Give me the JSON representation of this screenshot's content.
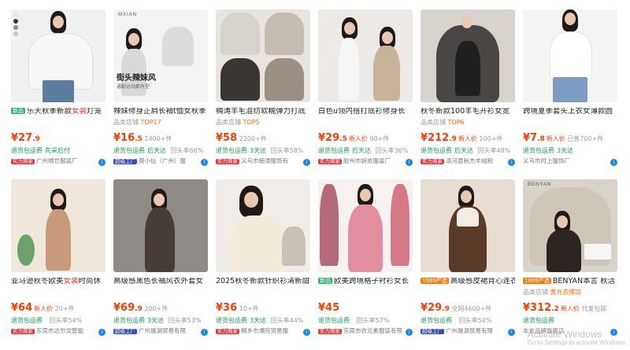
{
  "products": [
    {
      "tag": "新品",
      "tag_type": "g",
      "title": "乐天秋季新款",
      "title_red": "女装",
      "title_tail": "灯笼",
      "sub": "",
      "store": "",
      "price_int": "27",
      "price_dec": ".9",
      "new_label": "",
      "sales": "",
      "return_label": "退货包运费",
      "return_tail": "先采后付",
      "factory_label": "实力商家",
      "location": "广州绑世服装厂",
      "badge": "r"
    },
    {
      "tag": "",
      "tag_type": "",
      "title": "辣妹修身正肩长袖t恤女秋季",
      "title_red": "",
      "title_tail": "",
      "sub": "品类店铺",
      "store": "TOP17",
      "price_int": "16",
      "price_dec": ".5",
      "new_label": "",
      "sales": "2400+件",
      "return_label": "退货包运费",
      "return_tail": "后天达",
      "return_rate": "回头率66%",
      "factory_label": "超级工厂",
      "location": "莫小仙（广州）服",
      "badge": "b",
      "photo_label": "MXIAN",
      "photo_text": "街头辣妹风",
      "photo_sub": "通勤运动都有型"
    },
    {
      "tag": "",
      "tag_type": "",
      "title": "楠涛羊毛混纺软糯弹力打底",
      "title_red": "",
      "title_tail": "",
      "sub": "品类店铺",
      "store": "TOP5",
      "price_int": "58",
      "price_dec": "",
      "new_label": "",
      "sales": "2200+件",
      "return_label": "退货包运费",
      "return_tail": "3天达",
      "return_rate": "回头率58%",
      "factory_label": "实力商家",
      "location": "义乌市楠涛服饰有",
      "badge": "r"
    },
    {
      "tag": "",
      "tag_type": "",
      "title": "白色u领内搭打底衫修身长",
      "title_red": "",
      "title_tail": "",
      "sub": "",
      "store": "",
      "price_int": "29",
      "price_dec": ".5",
      "new_label": "新人价",
      "sales": "90+件",
      "return_label": "退货包运费",
      "return_tail": "后天达",
      "return_rate": "回头率36%",
      "factory_label": "实力商家",
      "location": "胶州市妍依服装厂",
      "badge": "r"
    },
    {
      "tag": "",
      "tag_type": "",
      "title": "秋冬新款100羊毛开衫女宽",
      "title_red": "",
      "title_tail": "",
      "sub": "品类店铺",
      "store": "TOP6",
      "price_int": "212",
      "price_dec": ".9",
      "new_label": "新人价",
      "sales": "100+件",
      "return_label": "退货包运费",
      "return_tail": "后天达",
      "return_rate": "回头率48%",
      "factory_label": "实力商家",
      "location": "清河县秋杰羊绒制",
      "badge": "r"
    },
    {
      "tag": "",
      "tag_type": "",
      "title": "跨境夏季套头上衣女薄款圆",
      "title_red": "",
      "title_tail": "",
      "sub": "",
      "store": "",
      "price_int": "7",
      "price_dec": ".8",
      "new_label": "新人价",
      "sales": "已售700+件",
      "return_label": "退货包运费",
      "return_tail": "3天达",
      "return_rate": "",
      "factory_label": "",
      "location": "义乌市时上服饰厂",
      "badge": ""
    },
    {
      "tag": "",
      "tag_type": "",
      "title": "亚马逊秋冬欧美",
      "title_red": "女装",
      "title_tail": "时尚休",
      "sub": "",
      "store": "",
      "price_int": "64",
      "price_dec": "",
      "new_label": "新人价",
      "sales": "20+件",
      "return_label": "退货包运费",
      "return_tail": "",
      "return_rate": "回头率54%",
      "factory_label": "实力商家",
      "location": "东莞市达尔文智能",
      "badge": "r"
    },
    {
      "tag": "",
      "tag_type": "",
      "title": "高级感黑色长袖风衣外套女",
      "title_red": "",
      "title_tail": "",
      "sub": "",
      "store": "",
      "price_int": "69",
      "price_dec": ".9",
      "new_label": "",
      "sales": "200+件",
      "return_label": "退货包运费",
      "return_tail": "3天达",
      "return_rate": "回头率53%",
      "factory_label": "超级工厂",
      "location": "广州晟湖贸易有限",
      "badge": "b"
    },
    {
      "tag": "",
      "tag_type": "",
      "title": "2025秋冬新款针织衫清新甜",
      "title_red": "",
      "title_tail": "",
      "sub": "",
      "store": "",
      "price_int": "36",
      "price_dec": "",
      "new_label": "",
      "sales": "10+件",
      "return_label": "退货包运费",
      "return_tail": "3天达",
      "return_rate": "回头率44%",
      "factory_label": "实力商家",
      "location": "桐乡市濮院贸易服",
      "badge": "r"
    },
    {
      "tag": "新品",
      "tag_type": "g",
      "title": "欧美跨境格子衬衫女长",
      "title_red": "",
      "title_tail": "",
      "sub": "",
      "store": "",
      "price_int": "45",
      "price_dec": "",
      "new_label": "",
      "sales": "",
      "return_label": "退货包运费",
      "return_tail": "",
      "return_rate": "回头率57%",
      "factory_label": "实力商家",
      "location": "东莞市衣元素服装有限",
      "badge": "r"
    },
    {
      "tag": "1688严选",
      "tag_type": "f",
      "title": "高级感皮裙背心连衣",
      "title_red": "",
      "title_tail": "",
      "sub": "",
      "store": "",
      "price_int": "29",
      "price_dec": ".9",
      "new_label": "",
      "sales": "全网4600+件",
      "return_label": "退货包运费",
      "return_tail": "",
      "return_rate": "回头率54%",
      "factory_label": "超级工厂",
      "location": "广州晟湖贸易有限",
      "badge": "b"
    },
    {
      "tag": "1688严选",
      "tag_type": "f",
      "title": "BENYAN本言 秋活",
      "title_red": "",
      "title_tail": "",
      "sub": "品类店铺",
      "store": "黄元衣撑店",
      "price_int": "312",
      "price_dec": ".2",
      "new_label": "新人价",
      "sales": "代发包邮",
      "return_label": "退货包运费",
      "return_tail": "",
      "return_rate": "",
      "factory_label": "",
      "location": "本言品牌旗舰店",
      "badge": "o",
      "photo_label": "BENYAN"
    }
  ],
  "watermark": {
    "line1": "Activate Windows",
    "line2": "Go to Settings to activate Windows."
  },
  "colors": {
    "price": "#ff3b00",
    "accent_green": "#1d9a55",
    "info": "#1e88e5"
  }
}
